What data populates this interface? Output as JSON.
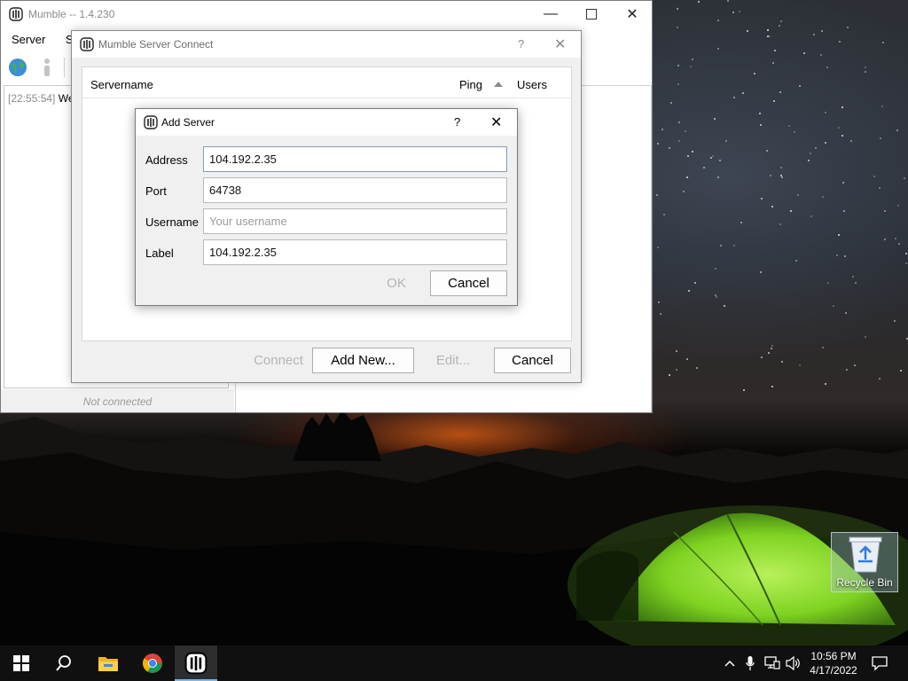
{
  "main_window": {
    "title": "Mumble -- 1.4.230",
    "menu": [
      "Server",
      "S"
    ],
    "log_timestamp": "[22:55:54]",
    "log_text": "Wel",
    "status": "Not connected"
  },
  "connect_dialog": {
    "title": "Mumble Server Connect",
    "help": "?",
    "columns": {
      "servername": "Servername",
      "ping": "Ping",
      "users": "Users"
    },
    "buttons": {
      "connect": "Connect",
      "add_new": "Add New...",
      "edit": "Edit...",
      "cancel": "Cancel"
    }
  },
  "add_server_dialog": {
    "title": "Add Server",
    "help": "?",
    "fields": {
      "address": {
        "label": "Address",
        "value": "104.192.2.35"
      },
      "port": {
        "label": "Port",
        "value": "64738"
      },
      "username": {
        "label": "Username",
        "value": "",
        "placeholder": "Your username"
      },
      "label": {
        "label": "Label",
        "value": "104.192.2.35"
      }
    },
    "buttons": {
      "ok": "OK",
      "cancel": "Cancel"
    }
  },
  "desktop": {
    "recycle_bin_label": "Recycle Bin"
  },
  "taskbar": {
    "apps": [
      "start-icon",
      "search-icon",
      "file-explorer-icon",
      "chrome-icon",
      "mumble-icon"
    ],
    "time": "10:56 PM",
    "date": "4/17/2022"
  },
  "colors": {
    "dialog_bg": "#f0f0f0",
    "taskbar_bg": "#101010",
    "disabled_text": "#b4b4b4",
    "tent_green": "#7ed321"
  }
}
